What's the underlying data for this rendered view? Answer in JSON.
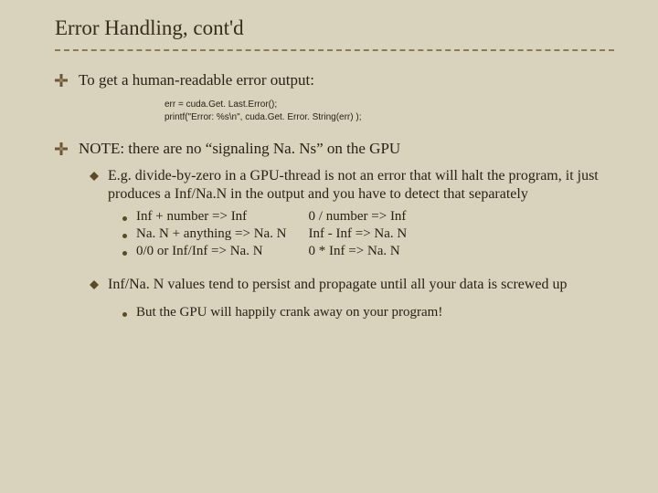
{
  "title": "Error Handling, cont'd",
  "bullets": {
    "b1": "To get a human-readable error output:",
    "code1": "err = cuda.Get. Last.Error();",
    "code2": "printf(\"Error: %s\\n\", cuda.Get. Error. String(err) );",
    "b2": "NOTE: there are no “signaling Na. Ns” on the GPU",
    "b2a": "E.g. divide-by-zero in a GPU-thread is not an error that will halt the program, it just produces a Inf/Na.N in the output and you have to detect that separately",
    "rules_left": [
      "Inf + number => Inf",
      "Na. N + anything => Na. N",
      "0/0 or Inf/Inf => Na. N"
    ],
    "rules_right": [
      "0 / number => Inf",
      "Inf - Inf => Na. N",
      "0 * Inf => Na. N"
    ],
    "b2b": "Inf/Na. N values tend to persist and propagate until all your data is screwed up",
    "b2b1": "But the GPU will happily crank away on your program!"
  }
}
